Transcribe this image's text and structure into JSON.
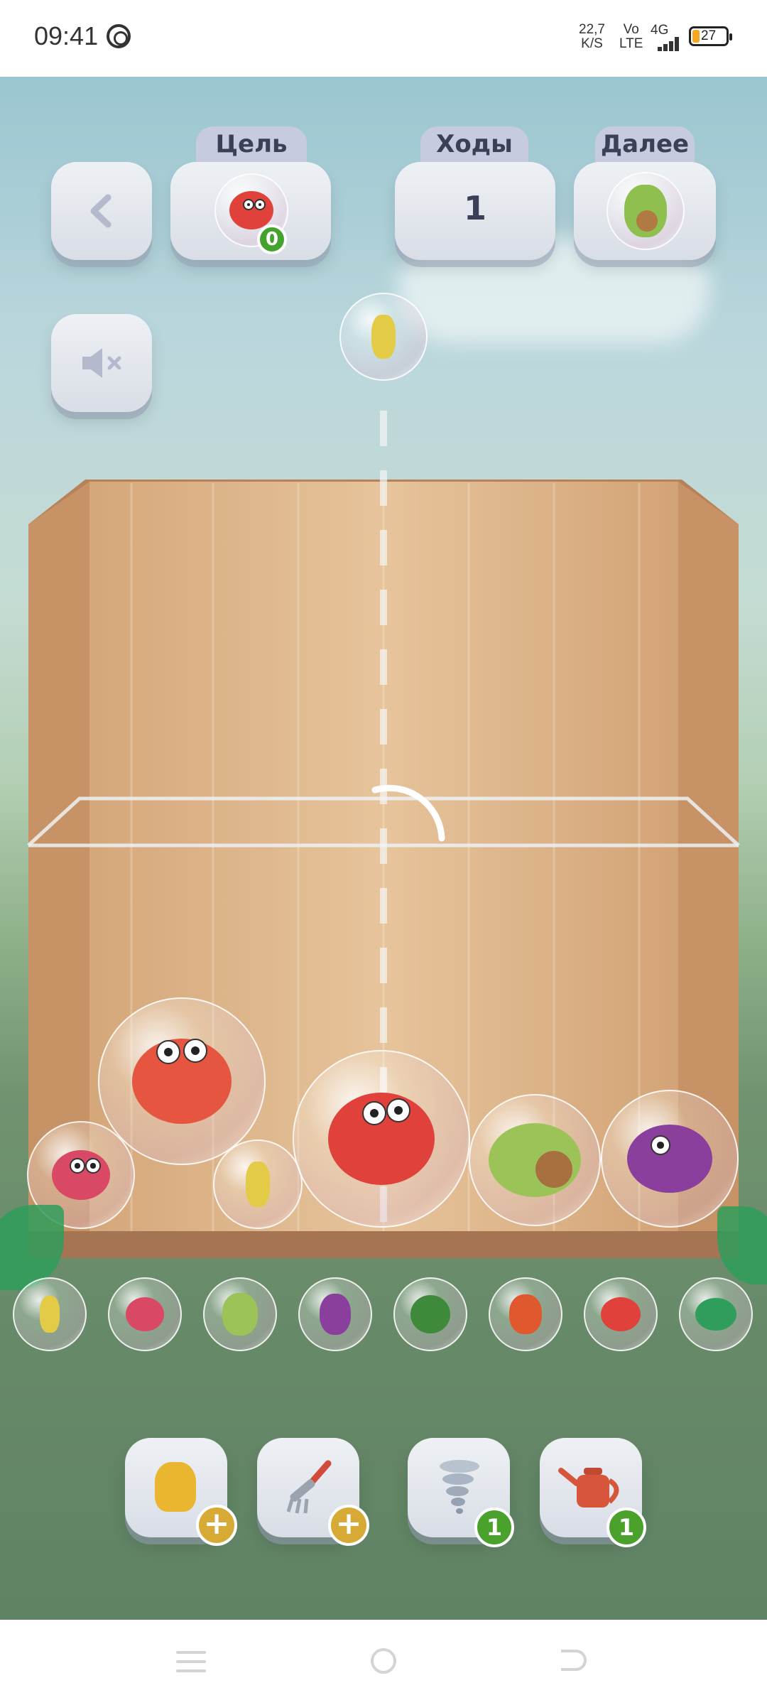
{
  "status_bar": {
    "time": "09:41",
    "speed_value": "22,7",
    "speed_unit": "K/S",
    "volte_top": "Vo",
    "volte_bottom": "LTE",
    "network": "4G",
    "battery": "27"
  },
  "hud": {
    "goal_label": "Цель",
    "goal_count": "0",
    "moves_label": "Ходы",
    "moves_value": "1",
    "next_label": "Далее"
  },
  "bottom_tray": [
    "corn",
    "raspberry",
    "avocado",
    "eggplant",
    "broccoli",
    "carrot",
    "tomato",
    "cactus"
  ],
  "tools": {
    "glove_badge": "+",
    "rake_badge": "+",
    "tornado_count": "1",
    "watering_can_count": "1"
  },
  "colors": {
    "accent_green": "#44a32e",
    "badge_gold": "#d7a935",
    "panel_text": "#3b3f57"
  }
}
